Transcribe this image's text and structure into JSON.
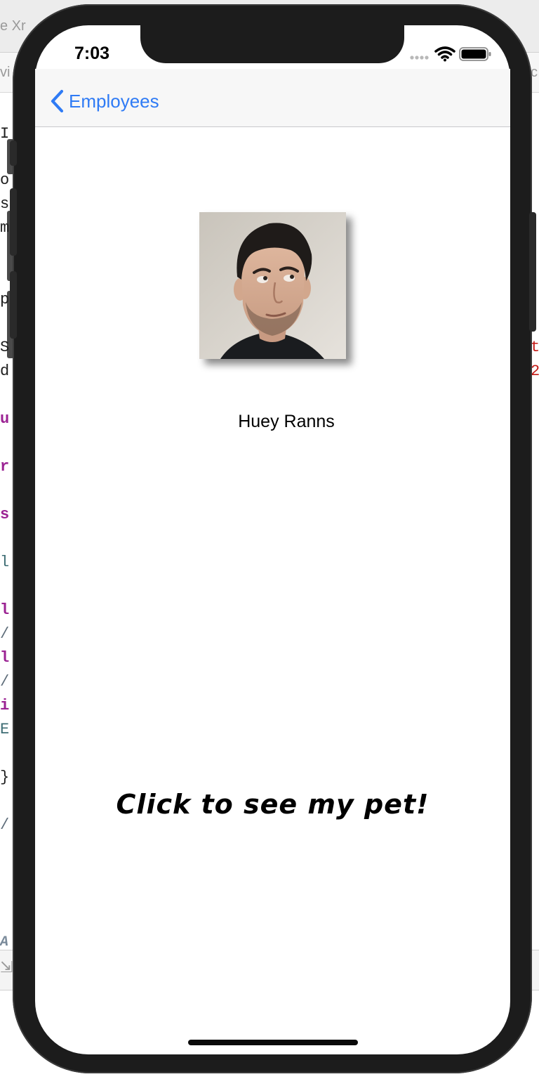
{
  "background": {
    "window_title_fragment": "e Xr",
    "tab_left_fragment": "vi",
    "tab_right_fragment": "c",
    "code_lines": [
      {
        "text": "I",
        "cls": ""
      },
      {
        "text": "o",
        "cls": ""
      },
      {
        "text": "s",
        "cls": ""
      },
      {
        "text": "m",
        "cls": ""
      },
      {
        "text": "p",
        "cls": ""
      },
      {
        "text": "S",
        "cls": ""
      },
      {
        "text": "d",
        "cls": ""
      },
      {
        "text": "u",
        "cls": "kw"
      },
      {
        "text": "r",
        "cls": "kw"
      },
      {
        "text": "s",
        "cls": "kw"
      },
      {
        "text": "l",
        "cls": "type"
      },
      {
        "text": "l",
        "cls": "kw"
      },
      {
        "text": "/",
        "cls": "cmt"
      },
      {
        "text": "l",
        "cls": "kw"
      },
      {
        "text": "/",
        "cls": "cmt"
      },
      {
        "text": "i",
        "cls": "kw"
      },
      {
        "text": "E",
        "cls": "type"
      },
      {
        "text": "}",
        "cls": ""
      },
      {
        "text": "/",
        "cls": "cmt"
      }
    ],
    "right_fragments": [
      "t",
      "2"
    ],
    "bottom_label_fragment": "A"
  },
  "status_bar": {
    "time": "7:03"
  },
  "nav": {
    "back_label": "Employees"
  },
  "employee": {
    "name": "Huey Ranns"
  },
  "pet_button": {
    "label": "Click to see my pet!"
  },
  "colors": {
    "accent": "#2f7bf5",
    "device_frame": "#1c1c1c"
  }
}
